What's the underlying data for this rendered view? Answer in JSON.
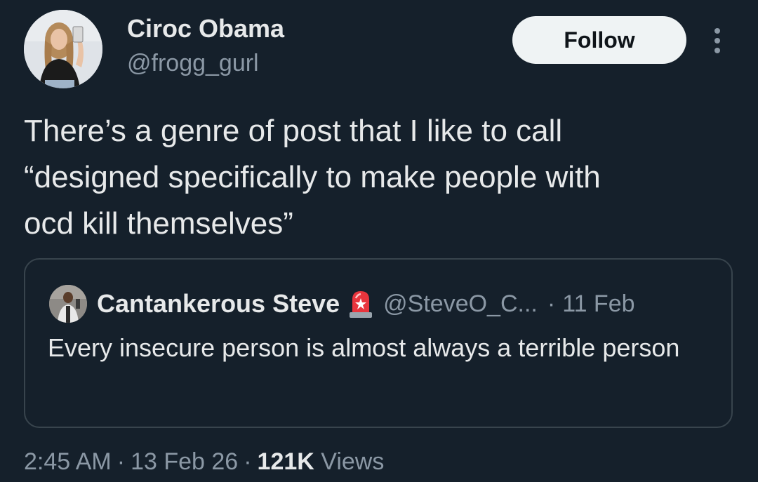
{
  "author": {
    "display_name": "Ciroc Obama",
    "handle": "@frogg_gurl"
  },
  "follow_label": "Follow",
  "more_icon": "more-vertical-icon",
  "post": {
    "text": "There’s a genre of post that I like to call\n“designed specifically to make people with\nocd kill themselves”"
  },
  "quoted": {
    "display_name": "Cantankerous Steve",
    "emoji": "rotating-light-icon",
    "handle": "@SteveO_C...",
    "separator": "·",
    "date": "11 Feb",
    "text": "Every insecure person is almost always a terrible person"
  },
  "meta": {
    "time": "2:45 AM",
    "separator": "·",
    "date": "13 Feb 26",
    "views_count": "121K",
    "views_label": "Views"
  },
  "colors": {
    "background": "#15202b",
    "text_primary": "#e7e9ea",
    "text_secondary": "#8b98a5",
    "border": "#38444d",
    "follow_button_bg": "#eff3f4"
  }
}
